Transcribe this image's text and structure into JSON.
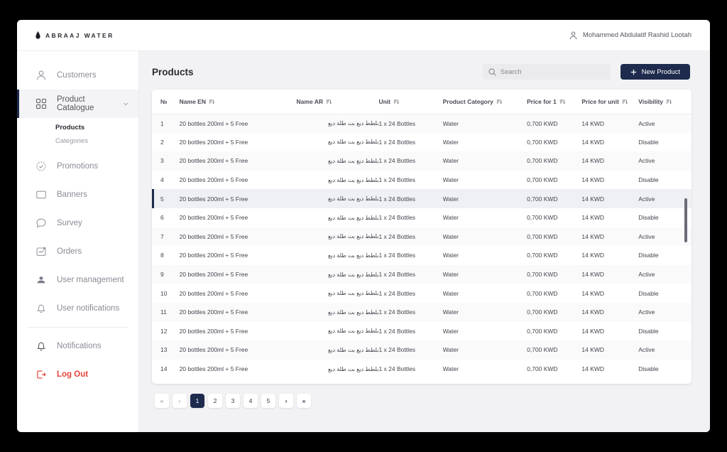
{
  "brand": {
    "name": "ABRAAJ WATER",
    "icon": "water-drop-icon"
  },
  "account": {
    "name": "Mohammed Abdulatif Rashid Lootah",
    "icon": "user-icon"
  },
  "sidebar": {
    "items": [
      {
        "label": "Customers",
        "icon": "user-icon",
        "active": false
      },
      {
        "label": "Product Catalogue",
        "icon": "grid-icon",
        "active": true,
        "expanded": true
      },
      {
        "label": "Promotions",
        "icon": "tag-icon",
        "active": false
      },
      {
        "label": "Banners",
        "icon": "image-icon",
        "active": false
      },
      {
        "label": "Survey",
        "icon": "chat-icon",
        "active": false
      },
      {
        "label": "Orders",
        "icon": "order-icon",
        "active": false
      },
      {
        "label": "User management",
        "icon": "users-icon",
        "active": false
      },
      {
        "label": "User notifications",
        "icon": "bell-icon",
        "active": false
      },
      {
        "label": "Notifications",
        "icon": "bell-icon",
        "active": false
      }
    ],
    "subitems": [
      {
        "label": "Products",
        "active": true
      },
      {
        "label": "Categories",
        "active": false
      }
    ],
    "logout": {
      "label": "Log Out",
      "icon": "logout-icon",
      "color": "#e8453c"
    }
  },
  "main": {
    "title": "Products",
    "search": {
      "placeholder": "Search",
      "value": "",
      "icon": "search-icon"
    },
    "new_product": {
      "label": "New Product",
      "icon": "plus-icon",
      "color": "#1e2b4d"
    }
  },
  "table": {
    "columns": [
      {
        "label": "№",
        "sortable": false
      },
      {
        "label": "Name EN",
        "sortable": true
      },
      {
        "label": "Name AR",
        "sortable": true
      },
      {
        "label": "Unit",
        "sortable": true
      },
      {
        "label": "Product Category",
        "sortable": true
      },
      {
        "label": "Price for 1",
        "sortable": true
      },
      {
        "label": "Price for unit",
        "sortable": true
      },
      {
        "label": "Visibility",
        "sortable": true
      }
    ],
    "selected_row": 5,
    "rows": [
      {
        "no": "1",
        "name_en": "20 bottles 200ml + 5 Free",
        "name_ar": "بلطط ديع بت طلة ديع",
        "unit": "1 x 24 Bottles",
        "category": "Water",
        "price_1": "0,700 KWD",
        "price_unit": "14 KWD",
        "visibility": "Active"
      },
      {
        "no": "2",
        "name_en": "20 bottles 200ml + 5 Free",
        "name_ar": "بلطط ديع بت طلة ديع",
        "unit": "1 x 24 Bottles",
        "category": "Water",
        "price_1": "0,700 KWD",
        "price_unit": "14 KWD",
        "visibility": "Disable"
      },
      {
        "no": "3",
        "name_en": "20 bottles 200ml + 5 Free",
        "name_ar": "بلطط ديع بت طلة ديع",
        "unit": "1 x 24 Bottles",
        "category": "Water",
        "price_1": "0,700 KWD",
        "price_unit": "14 KWD",
        "visibility": "Active"
      },
      {
        "no": "4",
        "name_en": "20 bottles 200ml + 5 Free",
        "name_ar": "بلطط ديع بت طلة ديع",
        "unit": "1 x 24 Bottles",
        "category": "Water",
        "price_1": "0,700 KWD",
        "price_unit": "14 KWD",
        "visibility": "Disable"
      },
      {
        "no": "5",
        "name_en": "20 bottles 200ml + 5 Free",
        "name_ar": "بلطط ديع بت طلة ديع",
        "unit": "1 x 24 Bottles",
        "category": "Water",
        "price_1": "0,700 KWD",
        "price_unit": "14 KWD",
        "visibility": "Active"
      },
      {
        "no": "6",
        "name_en": "20 bottles 200ml + 5 Free",
        "name_ar": "بلطط ديع بت طلة ديع",
        "unit": "1 x 24 Bottles",
        "category": "Water",
        "price_1": "0,700 KWD",
        "price_unit": "14 KWD",
        "visibility": "Disable"
      },
      {
        "no": "7",
        "name_en": "20 bottles 200ml + 5 Free",
        "name_ar": "بلطط ديع بت طلة ديع",
        "unit": "1 x 24 Bottles",
        "category": "Water",
        "price_1": "0,700 KWD",
        "price_unit": "14 KWD",
        "visibility": "Active"
      },
      {
        "no": "8",
        "name_en": "20 bottles 200ml + 5 Free",
        "name_ar": "بلطط ديع بت طلة ديع",
        "unit": "1 x 24 Bottles",
        "category": "Water",
        "price_1": "0,700 KWD",
        "price_unit": "14 KWD",
        "visibility": "Disable"
      },
      {
        "no": "9",
        "name_en": "20 bottles 200ml + 5 Free",
        "name_ar": "بلطط ديع بت طلة ديع",
        "unit": "1 x 24 Bottles",
        "category": "Water",
        "price_1": "0,700 KWD",
        "price_unit": "14 KWD",
        "visibility": "Active"
      },
      {
        "no": "10",
        "name_en": "20 bottles 200ml + 5 Free",
        "name_ar": "بلطط ديع بت طلة ديع",
        "unit": "1 x 24 Bottles",
        "category": "Water",
        "price_1": "0,700 KWD",
        "price_unit": "14 KWD",
        "visibility": "Disable"
      },
      {
        "no": "11",
        "name_en": "20 bottles 200ml + 5 Free",
        "name_ar": "بلطط ديع بت طلة ديع",
        "unit": "1 x 24 Bottles",
        "category": "Water",
        "price_1": "0,700 KWD",
        "price_unit": "14 KWD",
        "visibility": "Active"
      },
      {
        "no": "12",
        "name_en": "20 bottles 200ml + 5 Free",
        "name_ar": "بلطط ديع بت طلة ديع",
        "unit": "1 x 24 Bottles",
        "category": "Water",
        "price_1": "0,700 KWD",
        "price_unit": "14 KWD",
        "visibility": "Disable"
      },
      {
        "no": "13",
        "name_en": "20 bottles 200ml + 5 Free",
        "name_ar": "بلطط ديع بت طلة ديع",
        "unit": "1 x 24 Bottles",
        "category": "Water",
        "price_1": "0,700 KWD",
        "price_unit": "14 KWD",
        "visibility": "Active"
      },
      {
        "no": "14",
        "name_en": "20 bottles 200ml + 5 Free",
        "name_ar": "بلطط ديع بت طلة ديع",
        "unit": "1 x 24 Bottles",
        "category": "Water",
        "price_1": "0,700 KWD",
        "price_unit": "14 KWD",
        "visibility": "Disable"
      }
    ]
  },
  "pagination": {
    "first": "«",
    "prev": "‹",
    "next": "›",
    "last": "»",
    "pages": [
      "1",
      "2",
      "3",
      "4",
      "5"
    ],
    "current": "1"
  }
}
